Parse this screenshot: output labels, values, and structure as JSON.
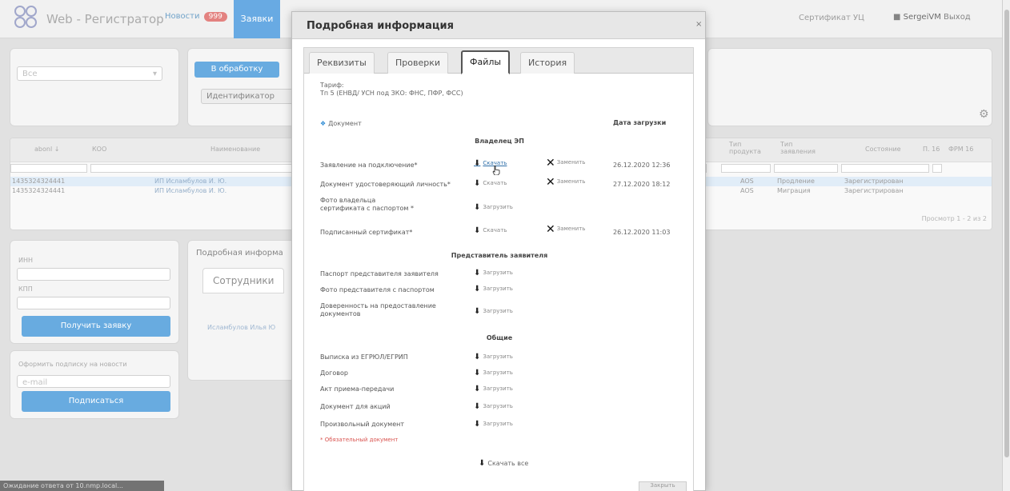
{
  "navbar": {
    "brand": "Web - Регистратор",
    "news_label": "Новости",
    "news_count": "999",
    "active_tab": "Заявки",
    "certificate_link": "Сертификат УЦ",
    "user": "SergeiVM",
    "logout": "Выход"
  },
  "background": {
    "filter_select": "Все",
    "work_button": "В обработку",
    "identifier_button": "Идентификатор",
    "table_headers": [
      "abonl ↓",
      "КОО",
      "Наименование",
      "Тип продукта",
      "Тип заявления",
      "Состояние",
      "П. 16",
      "ФРМ 16"
    ],
    "rows": [
      {
        "id": "1435324324441",
        "name": "ИП Исламбулов И. Ю.",
        "product": "AOS",
        "type": "Продление",
        "status": "Зарегистрирован"
      },
      {
        "id": "1435324324441",
        "name": "ИП Исламбулов И. Ю.",
        "product": "AOS",
        "type": "Миграция",
        "status": "Зарегистрирован"
      }
    ],
    "pager": "Просмотр 1 - 2 из 2",
    "left_label_inn": "ИНН",
    "left_label_kpp": "КПП",
    "get_request_button": "Получить заявку",
    "subscribe_label": "Оформить подписку на новости",
    "email_placeholder": "e-mail",
    "subscribe_button": "Подписаться",
    "detail_title": "Подробная информа",
    "employees_tab": "Сотрудники",
    "employee_name": "Исламбулов Илья Ю",
    "statusbar": "Ожидание ответа от 10.nmp.local..."
  },
  "modal": {
    "title": "Подробная информация",
    "close": "×",
    "tabs": [
      "Реквизиты",
      "Проверки",
      "Файлы",
      "История"
    ],
    "active_tab": "Файлы",
    "tariff_label": "Тариф:",
    "tariff_value": "Тп 5 (ЕНВД/ УСН под ЗКО: ФНС, ПФР, ФСС)",
    "document_header": "Документ",
    "date_header": "Дата загрузки",
    "sections": [
      {
        "title": "Владелец ЭП",
        "items": [
          {
            "name": "Заявление на подключение*",
            "action": "Скачать",
            "delete": "Заменить",
            "date": "26.12.2020 12:36"
          },
          {
            "name": "Документ удостоверяющий личность*",
            "action": "Скачать",
            "delete": "Заменить",
            "date": "27.12.2020 18:12"
          },
          {
            "name": "Фото владельца сертификата с паспортом *",
            "action": "Загрузить",
            "delete": "",
            "date": ""
          },
          {
            "name": "Подписанный сертификат*",
            "action": "Скачать",
            "delete": "Заменить",
            "date": "26.12.2020 11:03"
          }
        ]
      },
      {
        "title": "Представитель заявителя",
        "items": [
          {
            "name": "Паспорт представителя заявителя",
            "action": "Загрузить",
            "delete": "",
            "date": ""
          },
          {
            "name": "Фото представителя с паспортом",
            "action": "Загрузить",
            "delete": "",
            "date": ""
          },
          {
            "name": "Доверенность на предоставление документов",
            "action": "Загрузить",
            "delete": "",
            "date": ""
          }
        ]
      },
      {
        "title": "Общие",
        "items": [
          {
            "name": "Выписка из ЕГРЮЛ/ЕГРИП",
            "action": "Загрузить",
            "delete": "",
            "date": ""
          },
          {
            "name": "Договор",
            "action": "Загрузить",
            "delete": "",
            "date": ""
          },
          {
            "name": "Акт приема-передачи",
            "action": "Загрузить",
            "delete": "",
            "date": ""
          },
          {
            "name": "Документ для акций",
            "action": "Загрузить",
            "delete": "",
            "date": ""
          },
          {
            "name": "Произвольный документ",
            "action": "Загрузить",
            "delete": "",
            "date": ""
          }
        ]
      }
    ],
    "required_note": "* Обязательный документ",
    "download_all": "Скачать все",
    "close_button": "Закрыть"
  },
  "icons": {
    "download": "download-icon",
    "delete": "x-icon",
    "info": "info-icon",
    "gear": "gear-icon",
    "user": "user-icon"
  },
  "colors": {
    "accent": "#2e8bd4",
    "badge": "#d9534f",
    "required": "#d9534f"
  }
}
